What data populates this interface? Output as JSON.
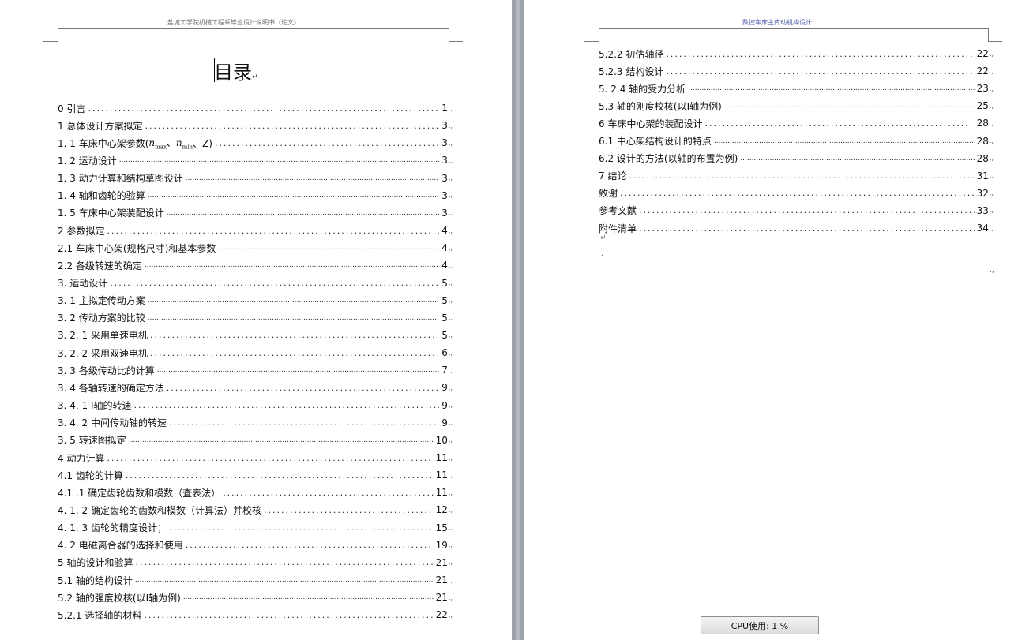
{
  "left_page": {
    "header": "盐城工学院机械工程系毕业设计说明书（论文）",
    "title": "目录",
    "toc": [
      {
        "label": "0 引言",
        "page": "1"
      },
      {
        "label": "1 总体设计方案拟定",
        "page": "3"
      },
      {
        "label": "1. 1  车床中心架参数(",
        "formula": true,
        "label_after": "、Z)",
        "page": "3"
      },
      {
        "label": "1. 2  运动设计",
        "page": "3"
      },
      {
        "label": "1. 3  动力计算和结构草图设计",
        "page": "3"
      },
      {
        "label": "1. 4  轴和齿轮的验算",
        "page": "3"
      },
      {
        "label": "1. 5  车床中心架装配设计",
        "page": "3"
      },
      {
        "label": "2  参数拟定",
        "page": "4"
      },
      {
        "label": "2.1  车床中心架(规格尺寸)和基本参数",
        "page": "4"
      },
      {
        "label": "2.2  各级转速的确定",
        "page": "4"
      },
      {
        "label": "3.   运动设计",
        "page": "5"
      },
      {
        "label": "3. 1  主拟定传动方案",
        "page": "5"
      },
      {
        "label": "3. 2  传动方案的比较",
        "page": "5"
      },
      {
        "label": "3. 2. 1  采用单速电机",
        "page": "5"
      },
      {
        "label": "3. 2. 2  采用双速电机",
        "page": "6"
      },
      {
        "label": "3. 3  各级传动比的计算",
        "page": "7"
      },
      {
        "label": "3. 4 各轴转速的确定方法",
        "page": "9"
      },
      {
        "label": "3. 4. 1  Ⅰ轴的转速",
        "page": "9"
      },
      {
        "label": "3. 4. 2   中间传动轴的转速",
        "page": "9"
      },
      {
        "label": "3. 5  转速图拟定",
        "page": "10"
      },
      {
        "label": "4  动力计算",
        "page": "11"
      },
      {
        "label": "4.1  齿轮的计算",
        "page": "11"
      },
      {
        "label": "4.1 .1 确定齿轮齿数和模数（查表法）",
        "page": "11"
      },
      {
        "label": "4. 1. 2  确定齿轮的齿数和模数（计算法）并校核",
        "page": "12"
      },
      {
        "label": "4. 1. 3  齿轮的精度设计；",
        "page": "15"
      },
      {
        "label": "4. 2   电磁离合器的选择和使用",
        "page": "19"
      },
      {
        "label": "5 轴的设计和验算",
        "page": "21"
      },
      {
        "label": "5.1  轴的结构设计",
        "page": "21"
      },
      {
        "label": "5.2  轴的强度校核(以Ⅰ轴为例)",
        "page": "21"
      },
      {
        "label": "5.2.1  选择轴的材料",
        "page": "22"
      }
    ],
    "formula": {
      "n": "n",
      "max": "max",
      "min": "min",
      "sep": "、"
    }
  },
  "right_page": {
    "header": "数控车床主传动机构设计",
    "toc": [
      {
        "label": "5.2.2  初估轴径",
        "page": "22"
      },
      {
        "label": "5.2.3  结构设计",
        "page": "22"
      },
      {
        "label": "5. 2.4  轴的受力分析",
        "page": "23"
      },
      {
        "label": "5.3  轴的刚度校核(以Ⅰ轴为例)",
        "page": "25"
      },
      {
        "label": "6 车床中心架的装配设计",
        "page": "28"
      },
      {
        "label": "6.1  中心架结构设计的特点",
        "page": "28"
      },
      {
        "label": "6.2  设计的方法(以轴的布置为例)",
        "page": "28"
      },
      {
        "label": "7 结论",
        "page": "31"
      },
      {
        "label": "致谢",
        "page": "32"
      },
      {
        "label": "参考文献",
        "page": "33"
      },
      {
        "label": "附件清单",
        "page": "34"
      }
    ],
    "para_mark": "↵",
    "dot_mark": ".",
    "corner_mark": ".,"
  },
  "status": {
    "cpu_label": "CPU使用: 1 %"
  },
  "marks": {
    "para": "↵",
    "end": ".,"
  }
}
